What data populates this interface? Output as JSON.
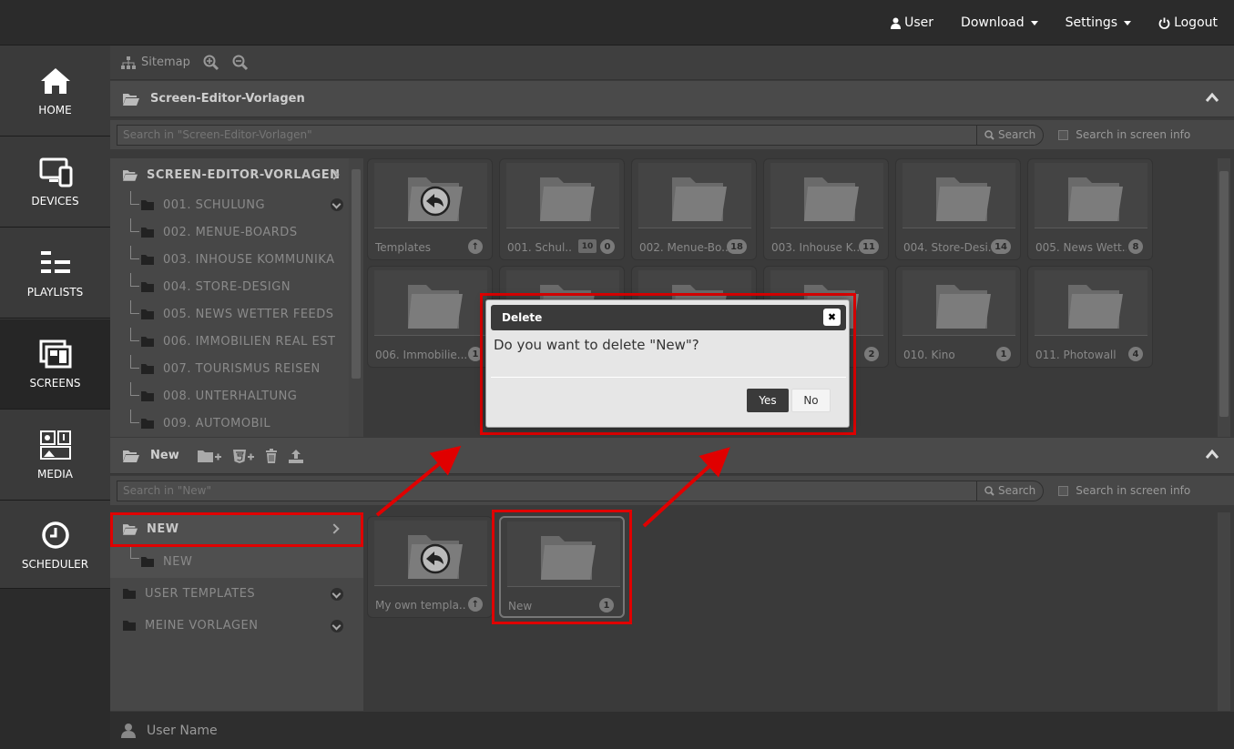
{
  "topnav": {
    "user": "User",
    "download": "Download",
    "settings": "Settings",
    "logout": "Logout"
  },
  "leftnav": [
    {
      "label": "HOME",
      "icon": "home-icon"
    },
    {
      "label": "DEVICES",
      "icon": "devices-icon"
    },
    {
      "label": "PLAYLISTS",
      "icon": "playlists-icon"
    },
    {
      "label": "SCREENS",
      "icon": "screens-icon"
    },
    {
      "label": "MEDIA",
      "icon": "media-icon"
    },
    {
      "label": "SCHEDULER",
      "icon": "clock-icon"
    }
  ],
  "toolbar": {
    "sitemap": "Sitemap"
  },
  "panel1": {
    "title": "Screen-Editor-Vorlagen",
    "search_placeholder": "Search in \"Screen-Editor-Vorlagen\"",
    "search_label": "Search",
    "search_info": "Search in screen info",
    "tree_root": "SCREEN-EDITOR-VORLAGEN",
    "tree_items": [
      "001. SCHULUNG",
      "002. MENUE-BOARDS",
      "003. INHOUSE KOMMUNIKA",
      "004. STORE-DESIGN",
      "005. NEWS WETTER FEEDS",
      "006. IMMOBILIEN REAL EST",
      "007. TOURISMUS REISEN",
      "008. UNTERHALTUNG",
      "009. AUTOMOBIL"
    ],
    "tiles": [
      {
        "label": "Templates",
        "count": ""
      },
      {
        "label": "001. Schul...",
        "sub": "10",
        "count": "0"
      },
      {
        "label": "002. Menue-Bo...",
        "count": "18"
      },
      {
        "label": "003. Inhouse K...",
        "count": "11"
      },
      {
        "label": "004. Store-Desi...",
        "count": "14"
      },
      {
        "label": "005. News Wett...",
        "count": "8"
      },
      {
        "label": "006. Immobilie...",
        "count": "1"
      },
      {
        "label": "",
        "count": ""
      },
      {
        "label": "",
        "count": ""
      },
      {
        "label": "",
        "count": "2"
      },
      {
        "label": "010. Kino",
        "count": "1"
      },
      {
        "label": "011. Photowall",
        "count": "4"
      }
    ]
  },
  "panel2": {
    "title": "New",
    "search_placeholder": "Search in \"New\"",
    "search_label": "Search",
    "search_info": "Search in screen info",
    "tree_root": "NEW",
    "tree_child": "NEW",
    "tree_items": [
      "USER TEMPLATES",
      "MEINE VORLAGEN"
    ],
    "tiles": [
      {
        "label": "My own templa...",
        "count": ""
      },
      {
        "label": "New",
        "count": "1"
      }
    ]
  },
  "status": {
    "user_name": "User Name"
  },
  "dialog": {
    "title": "Delete",
    "message": "Do you want to delete \"New\"?",
    "yes": "Yes",
    "no": "No",
    "close": "✖"
  },
  "colors": {
    "highlight": "#e00000"
  }
}
